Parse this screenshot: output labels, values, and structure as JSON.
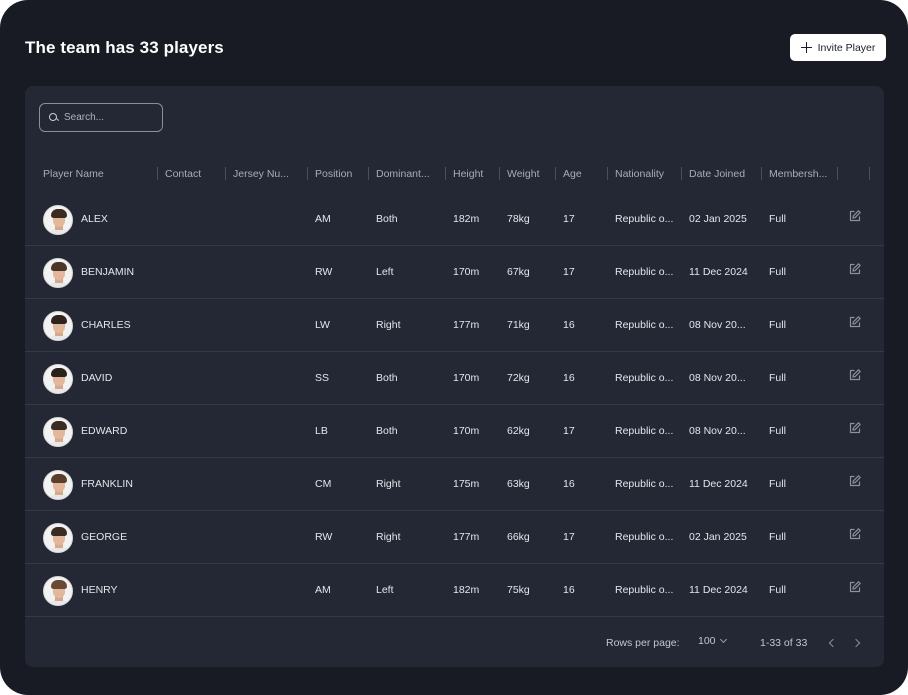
{
  "header": {
    "title": "The team has 33 players",
    "invite_label": "Invite Player"
  },
  "search": {
    "placeholder": "Search..."
  },
  "columns": [
    "Player Name",
    "Contact",
    "Jersey Nu...",
    "Position",
    "Dominant...",
    "Height",
    "Weight",
    "Age",
    "Nationality",
    "Date Joined",
    "Membersh..."
  ],
  "players": [
    {
      "name": "ALEX",
      "contact": "",
      "jersey": "",
      "position": "AM",
      "dominant": "Both",
      "height": "182m",
      "weight": "78kg",
      "age": "17",
      "nationality": "Republic o...",
      "joined": "02 Jan 2025",
      "membership": "Full"
    },
    {
      "name": "BENJAMIN",
      "contact": "",
      "jersey": "",
      "position": "RW",
      "dominant": "Left",
      "height": "170m",
      "weight": "67kg",
      "age": "17",
      "nationality": "Republic o...",
      "joined": "11 Dec 2024",
      "membership": "Full"
    },
    {
      "name": "CHARLES",
      "contact": "",
      "jersey": "",
      "position": "LW",
      "dominant": "Right",
      "height": "177m",
      "weight": "71kg",
      "age": "16",
      "nationality": "Republic o...",
      "joined": "08 Nov 20...",
      "membership": "Full"
    },
    {
      "name": "DAVID",
      "contact": "",
      "jersey": "",
      "position": "SS",
      "dominant": "Both",
      "height": "170m",
      "weight": "72kg",
      "age": "16",
      "nationality": "Republic o...",
      "joined": "08 Nov 20...",
      "membership": "Full"
    },
    {
      "name": "EDWARD",
      "contact": "",
      "jersey": "",
      "position": "LB",
      "dominant": "Both",
      "height": "170m",
      "weight": "62kg",
      "age": "17",
      "nationality": "Republic o...",
      "joined": "08 Nov 20...",
      "membership": "Full"
    },
    {
      "name": "FRANKLIN",
      "contact": "",
      "jersey": "",
      "position": "CM",
      "dominant": "Right",
      "height": "175m",
      "weight": "63kg",
      "age": "16",
      "nationality": "Republic o...",
      "joined": "11 Dec 2024",
      "membership": "Full"
    },
    {
      "name": "GEORGE",
      "contact": "",
      "jersey": "",
      "position": "RW",
      "dominant": "Right",
      "height": "177m",
      "weight": "66kg",
      "age": "17",
      "nationality": "Republic o...",
      "joined": "02 Jan 2025",
      "membership": "Full"
    },
    {
      "name": "HENRY",
      "contact": "",
      "jersey": "",
      "position": "AM",
      "dominant": "Left",
      "height": "182m",
      "weight": "75kg",
      "age": "16",
      "nationality": "Republic o...",
      "joined": "11 Dec 2024",
      "membership": "Full"
    }
  ],
  "footer": {
    "rows_per_page_label": "Rows per page:",
    "rows_per_page_value": "100",
    "range": "1-33 of 33"
  },
  "icons": {
    "add": "plus-icon",
    "search": "search-icon",
    "edit": "edit-icon",
    "dropdown": "chevron-down-icon",
    "prev": "chevron-left-icon",
    "next": "chevron-right-icon"
  },
  "colors": {
    "frame_bg": "#181b24",
    "card_bg": "#242834",
    "text": "#e4e6ec",
    "muted": "#a8acb6"
  }
}
